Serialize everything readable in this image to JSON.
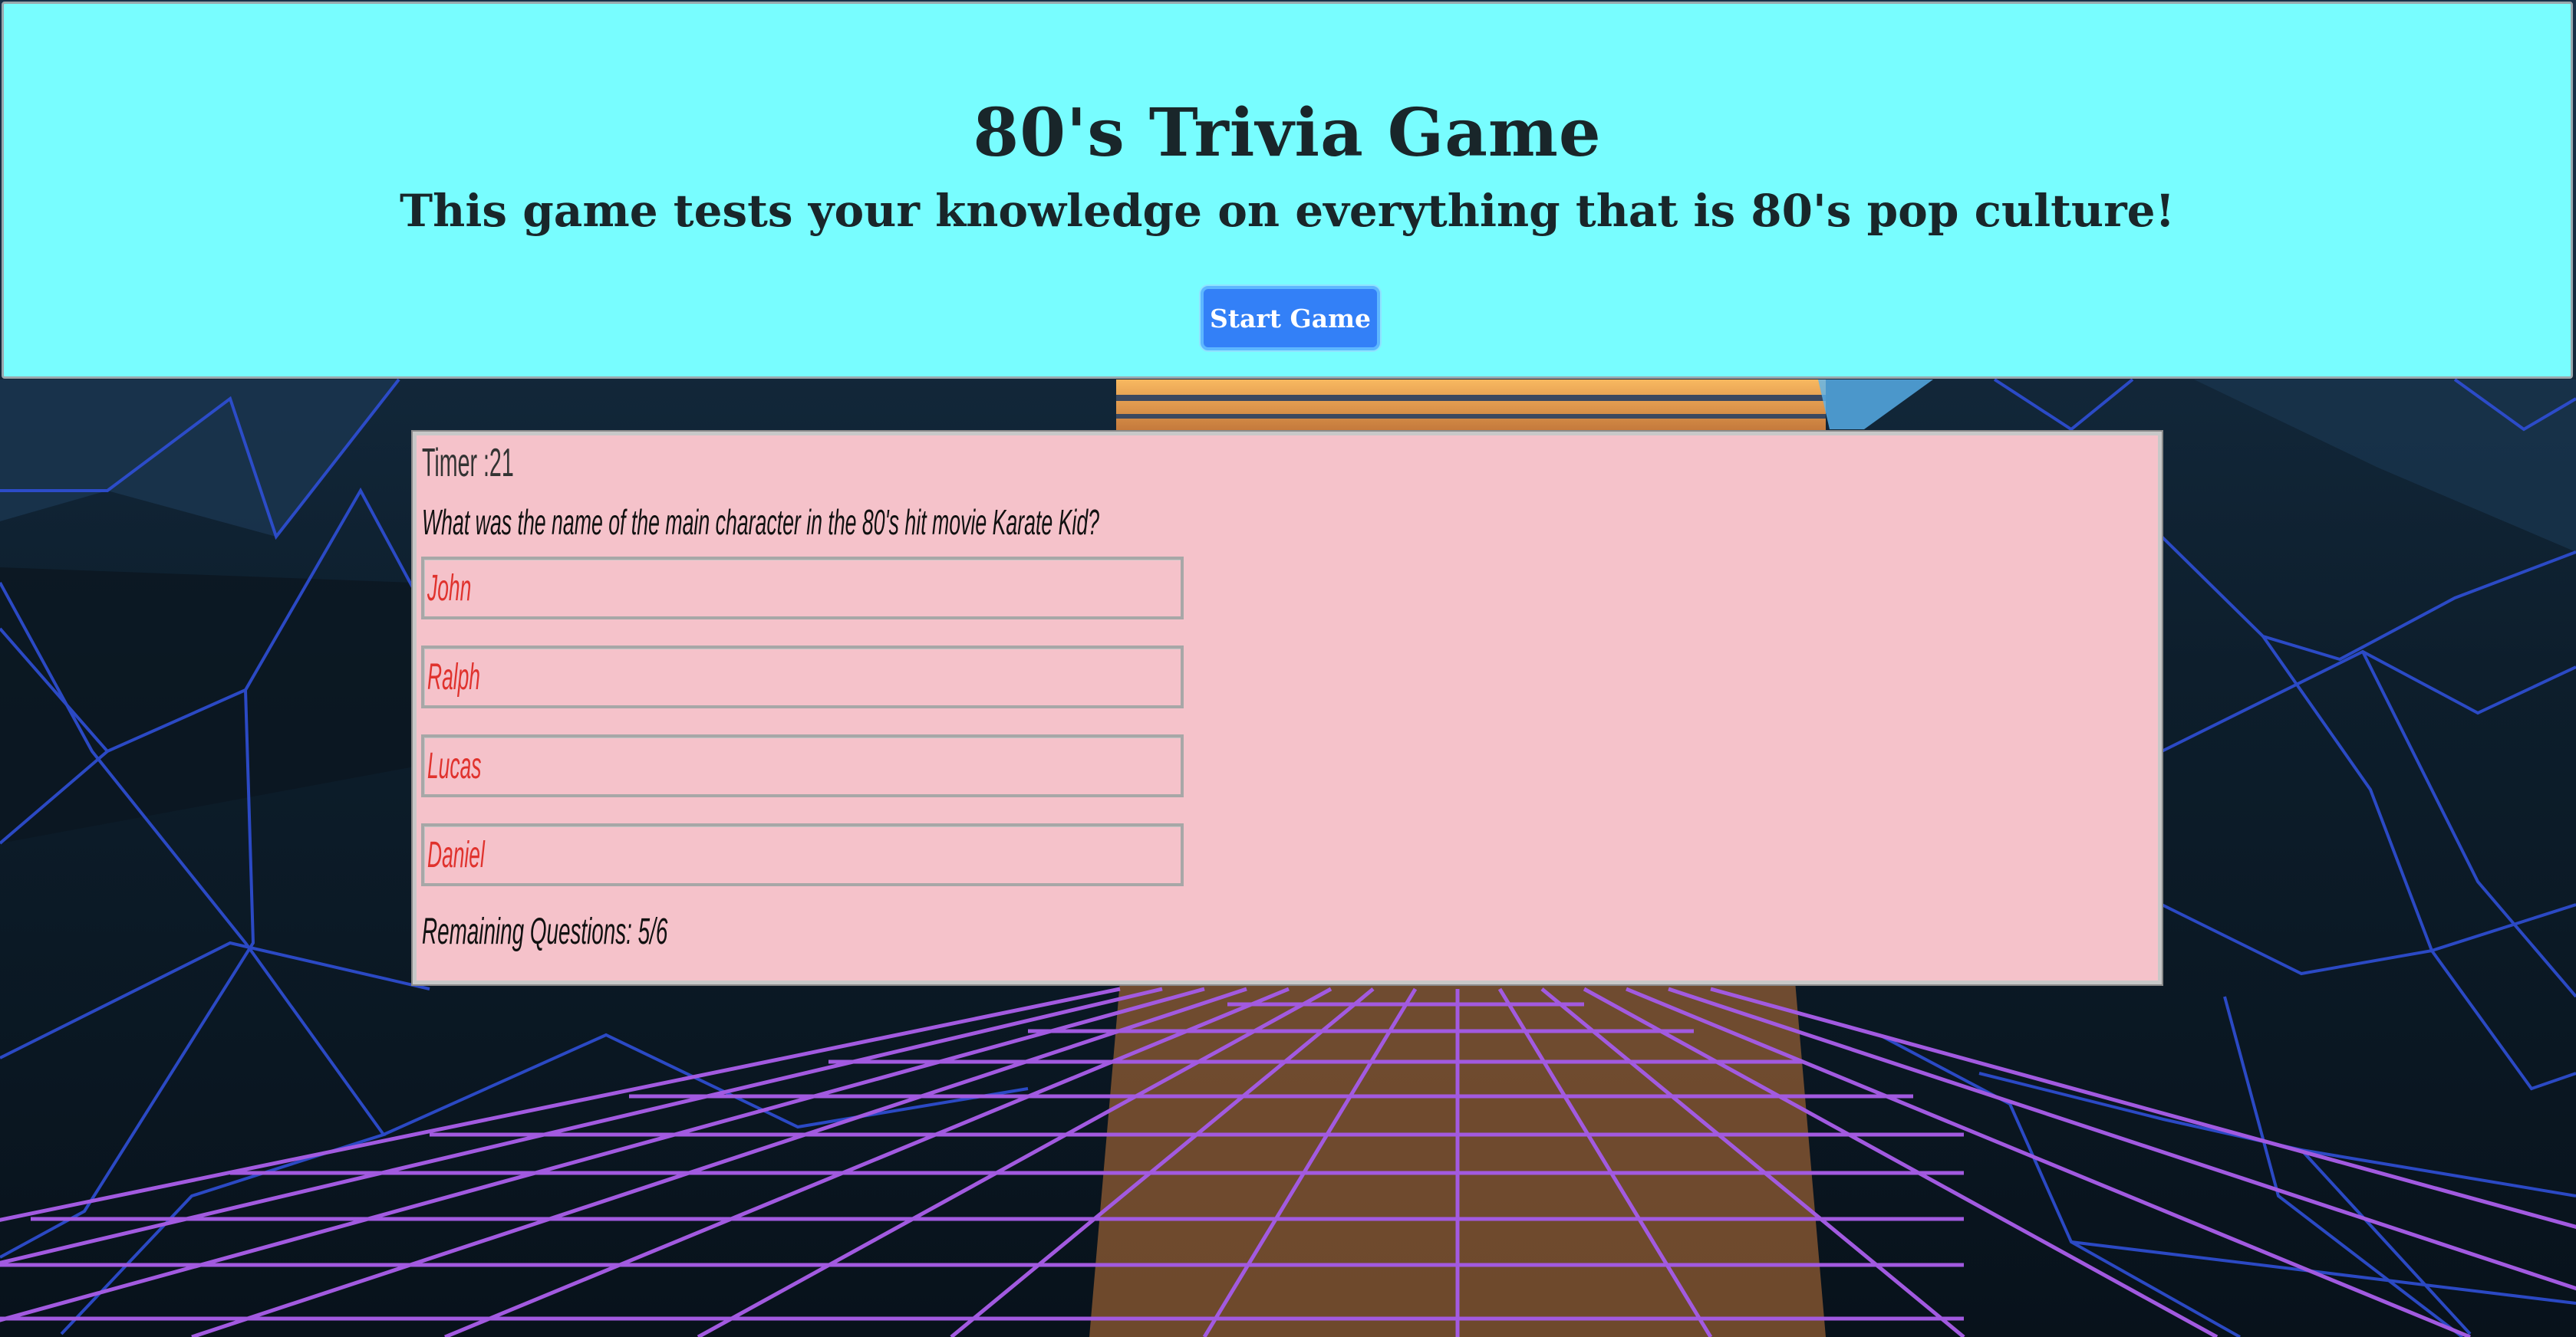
{
  "header": {
    "title": "80's Trivia Game",
    "subtitle": "This game tests your knowledge on everything that is 80's pop culture!",
    "start_button_label": "Start Game"
  },
  "quiz": {
    "timer_text": "Timer :21",
    "question": "What was the name of the main character in the 80's hit movie Karate Kid?",
    "answers": [
      "John",
      "Ralph",
      "Lucas",
      "Daniel"
    ],
    "remaining_text": "Remaining Questions: 5/6"
  },
  "colors": {
    "header_background": "#78fdff",
    "button_background": "#3380f7",
    "quiz_background": "#f5c2ca",
    "answer_text": "#e0322d",
    "grid_purple": "#a25ae0",
    "mountain_lines": "#2f4fd6",
    "sun_orange": "#f6a64d"
  }
}
